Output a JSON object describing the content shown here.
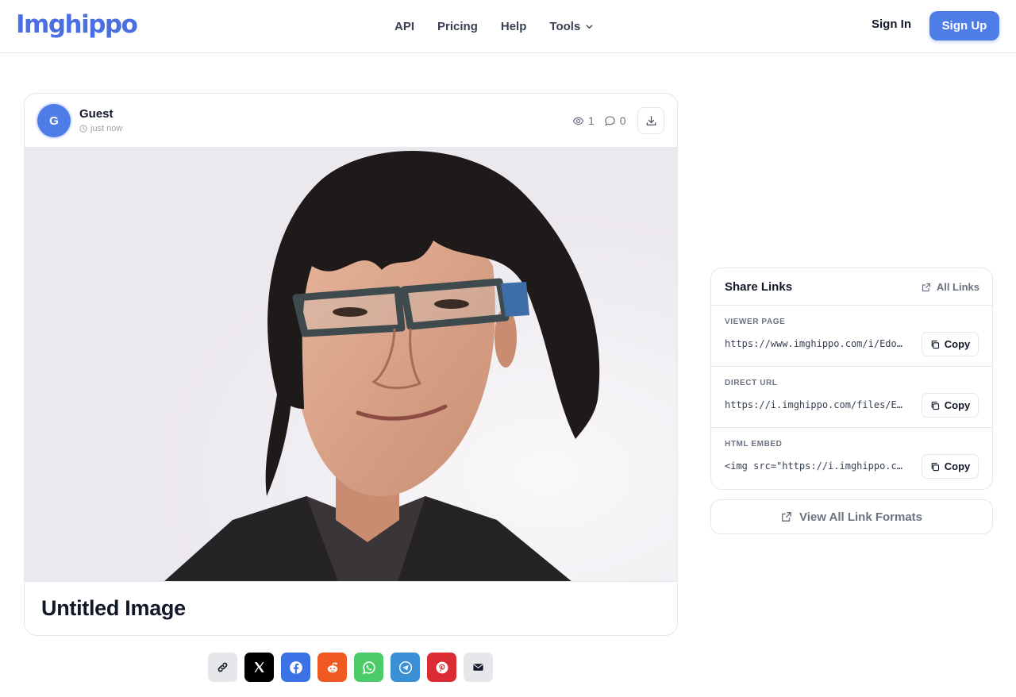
{
  "header": {
    "logo": "Imghippo",
    "nav": [
      {
        "label": "API"
      },
      {
        "label": "Pricing"
      },
      {
        "label": "Help"
      }
    ],
    "tools_label": "Tools",
    "sign_in": "Sign In",
    "sign_up": "Sign Up"
  },
  "post": {
    "avatar_initial": "G",
    "user": "Guest",
    "time": "just now",
    "views": "1",
    "comments": "0",
    "title": "Untitled Image"
  },
  "share_buttons": [
    {
      "name": "copy-link",
      "icon": "link-icon",
      "color": "#e5e7eb"
    },
    {
      "name": "x",
      "icon": "x-logo-icon",
      "color": "#000000"
    },
    {
      "name": "facebook",
      "icon": "facebook-icon",
      "color": "#3b72e6"
    },
    {
      "name": "reddit",
      "icon": "reddit-icon",
      "color": "#f05a22"
    },
    {
      "name": "whatsapp",
      "icon": "whatsapp-icon",
      "color": "#4ccc68"
    },
    {
      "name": "telegram",
      "icon": "telegram-icon",
      "color": "#3b8fd4"
    },
    {
      "name": "pinterest",
      "icon": "pinterest-icon",
      "color": "#db2b33"
    },
    {
      "name": "email",
      "icon": "mail-icon",
      "color": "#e5e7eb"
    }
  ],
  "share_panel": {
    "title": "Share Links",
    "all_links": "All Links",
    "rows": [
      {
        "label": "VIEWER PAGE",
        "value": "https://www.imghippo.com/i/Edo…",
        "copy": "Copy"
      },
      {
        "label": "DIRECT URL",
        "value": "https://i.imghippo.com/files/E…",
        "copy": "Copy"
      },
      {
        "label": "HTML EMBED",
        "value": "<img src=\"https://i.imghippo.c…",
        "copy": "Copy"
      }
    ],
    "view_all": "View All Link Formats"
  },
  "colors": {
    "brand": "#4a6fe3",
    "primary_button": "#4f7de8",
    "border": "#e5e7eb",
    "muted_text": "#6b7280"
  }
}
